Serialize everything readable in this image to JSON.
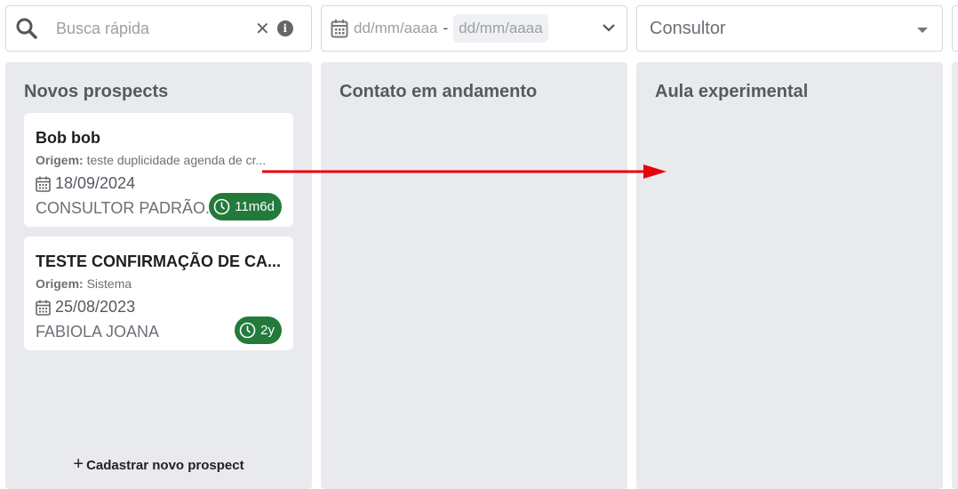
{
  "search": {
    "placeholder": "Busca rápida",
    "value": "",
    "clear_symbol": "✕",
    "info_symbol": "i"
  },
  "date_filter": {
    "start_placeholder": "dd/mm/aaaa",
    "separator": "-",
    "end_placeholder": "dd/mm/aaaa"
  },
  "consultor_filter": {
    "label": "Consultor"
  },
  "columns": [
    {
      "title": "Novos prospects",
      "cards": [
        {
          "name": "Bob bob",
          "origem_label": "Origem:",
          "origem_value": "teste duplicidade agenda de cr...",
          "date": "18/09/2024",
          "consultor": "CONSULTOR PADRÃO...",
          "badge": "11m6d"
        },
        {
          "name": "TESTE CONFIRMAÇÃO DE CA...",
          "origem_label": "Origem:",
          "origem_value": "Sistema",
          "date": "25/08/2023",
          "consultor": "FABIOLA JOANA",
          "badge": "2y"
        }
      ],
      "add_label": "Cadastrar novo prospect",
      "add_symbol": "+"
    },
    {
      "title": "Contato em andamento",
      "cards": []
    },
    {
      "title": "Aula experimental",
      "cards": []
    }
  ],
  "colors": {
    "badge_green": "#237a3b",
    "arrow_red": "#e8000b",
    "column_bg": "#e9eaed"
  },
  "icons": [
    "search-icon",
    "clear-icon",
    "info-icon",
    "calendar-icon",
    "chevron-down-icon",
    "caret-down-icon",
    "clock-icon",
    "plus-icon"
  ]
}
